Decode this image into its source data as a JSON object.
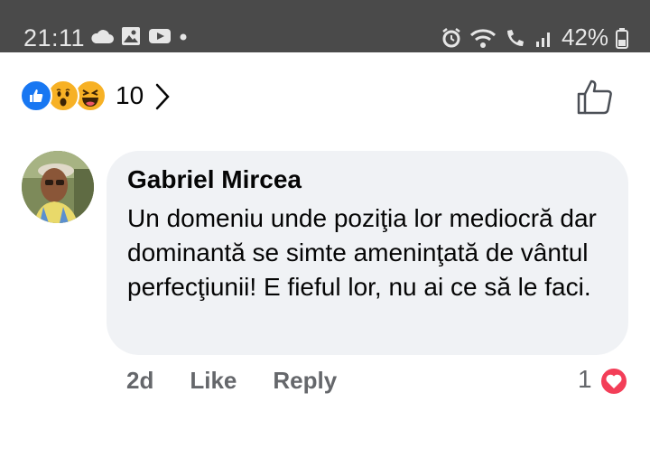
{
  "status_bar": {
    "time": "21:11",
    "battery": "42%",
    "icons_left": [
      "cloud-icon",
      "image-icon",
      "youtube-icon",
      "dot-icon"
    ],
    "icons_right": [
      "alarm-icon",
      "wifi-icon",
      "wifi-call-icon",
      "signal-icon",
      "battery-icon"
    ]
  },
  "reactions": {
    "types": [
      "like",
      "wow",
      "haha"
    ],
    "count": "10"
  },
  "comment": {
    "author": "Gabriel Mircea",
    "text": "Un domeniu unde poziţia lor mediocră dar dominantă se simte ameninţată de vântul perfecţiunii! E fieful lor, nu ai ce să le faci.",
    "time": "2d",
    "like_label": "Like",
    "reply_label": "Reply",
    "reaction_count": "1",
    "reaction_type": "love"
  },
  "colors": {
    "status_bar_bg": "#4a4a4a",
    "bubble_bg": "#f0f2f5",
    "meta_text": "#65676b",
    "love_red": "#f33e58",
    "like_blue": "#1877f2",
    "emoji_yellow": "#f7b125"
  }
}
